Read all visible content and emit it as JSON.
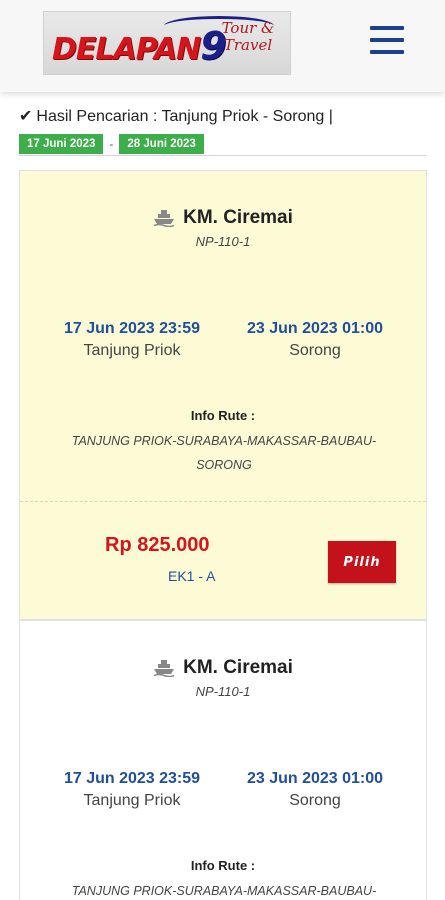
{
  "header": {
    "logo_main": "DELAPAN",
    "logo_nine": "9",
    "logo_sub": "Tour & Travel",
    "menu_icon": "hamburger-icon"
  },
  "search": {
    "check_icon": "✔",
    "result_text": "Hasil Pencarian : Tanjung Priok - Sorong |",
    "date_from": "17 Juni 2023",
    "separator": "-",
    "date_to": "28 Juni 2023"
  },
  "results": [
    {
      "ship_name": "KM. Ciremai",
      "ship_code": "NP-110-1",
      "departure_time": "17 Jun 2023 23:59",
      "departure_place": "Tanjung Priok",
      "arrival_time": "23 Jun 2023 01:00",
      "arrival_place": "Sorong",
      "route_label": "Info Rute :",
      "route": "TANJUNG PRIOK-SURABAYA-MAKASSAR-BAUBAU-SORONG",
      "price": "Rp 825.000",
      "class_code": "EK1  -  A",
      "select_label": "Pilih"
    },
    {
      "ship_name": "KM. Ciremai",
      "ship_code": "NP-110-1",
      "departure_time": "17 Jun 2023 23:59",
      "departure_place": "Tanjung Priok",
      "arrival_time": "23 Jun 2023 01:00",
      "arrival_place": "Sorong",
      "route_label": "Info Rute :",
      "route": "TANJUNG PRIOK-SURABAYA-MAKASSAR-BAUBAU-"
    }
  ],
  "colors": {
    "accent_blue": "#1f4f9a",
    "price_red": "#d7141c",
    "badge_green": "#3cae4a",
    "card_highlight": "#fdfad6"
  }
}
